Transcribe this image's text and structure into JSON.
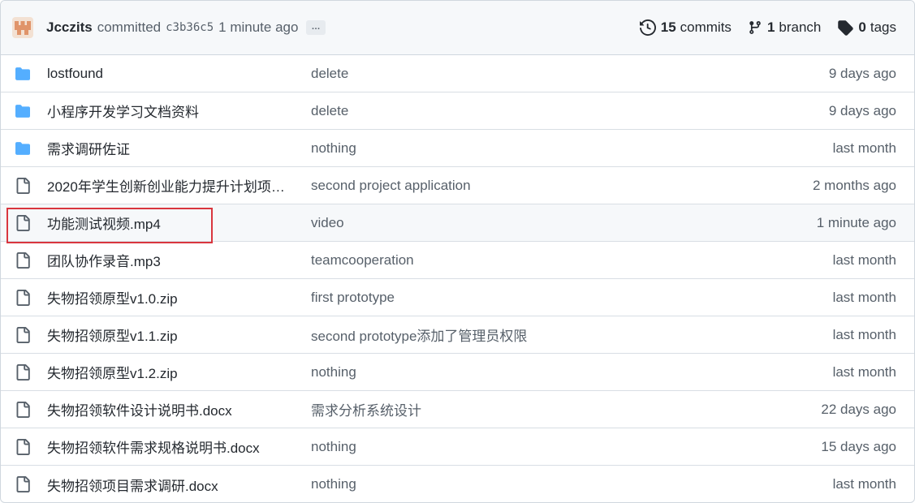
{
  "commit": {
    "author": "Jcczits",
    "verb": "committed",
    "sha": "c3b36c5",
    "time": "1 minute ago",
    "ellipsis": "…"
  },
  "stats": {
    "commits_count": "15",
    "commits_label": "commits",
    "branch_count": "1",
    "branch_label": "branch",
    "tags_count": "0",
    "tags_label": "tags"
  },
  "files": [
    {
      "type": "folder",
      "name": "lostfound",
      "message": "delete",
      "age": "9 days ago"
    },
    {
      "type": "folder",
      "name": "小程序开发学习文档资料",
      "message": "delete",
      "age": "9 days ago"
    },
    {
      "type": "folder",
      "name": "需求调研佐证",
      "message": "nothing",
      "age": "last month"
    },
    {
      "type": "file",
      "name": "2020年学生创新创业能力提升计划项…",
      "message": "second project application",
      "age": "2 months ago"
    },
    {
      "type": "file",
      "name": "功能测试视频.mp4",
      "message": "video",
      "age": "1 minute ago",
      "highlighted": true
    },
    {
      "type": "file",
      "name": "团队协作录音.mp3",
      "message": "teamcooperation",
      "age": "last month"
    },
    {
      "type": "file",
      "name": "失物招领原型v1.0.zip",
      "message": "first prototype",
      "age": "last month"
    },
    {
      "type": "file",
      "name": "失物招领原型v1.1.zip",
      "message": "second prototype添加了管理员权限",
      "age": "last month"
    },
    {
      "type": "file",
      "name": "失物招领原型v1.2.zip",
      "message": "nothing",
      "age": "last month"
    },
    {
      "type": "file",
      "name": "失物招领软件设计说明书.docx",
      "message": "需求分析系统设计",
      "age": "22 days ago"
    },
    {
      "type": "file",
      "name": "失物招领软件需求规格说明书.docx",
      "message": "nothing",
      "age": "15 days ago"
    },
    {
      "type": "file",
      "name": "失物招领项目需求调研.docx",
      "message": "nothing",
      "age": "last month"
    }
  ],
  "icons": {
    "folder": "folder-icon",
    "file": "file-icon",
    "history": "history-icon",
    "branch": "git-branch-icon",
    "tag": "tag-icon"
  },
  "colors": {
    "folder": "#54aeff",
    "file_icon": "#57606a",
    "highlight_border": "#d9363e",
    "avatar": "#e8a87c"
  }
}
